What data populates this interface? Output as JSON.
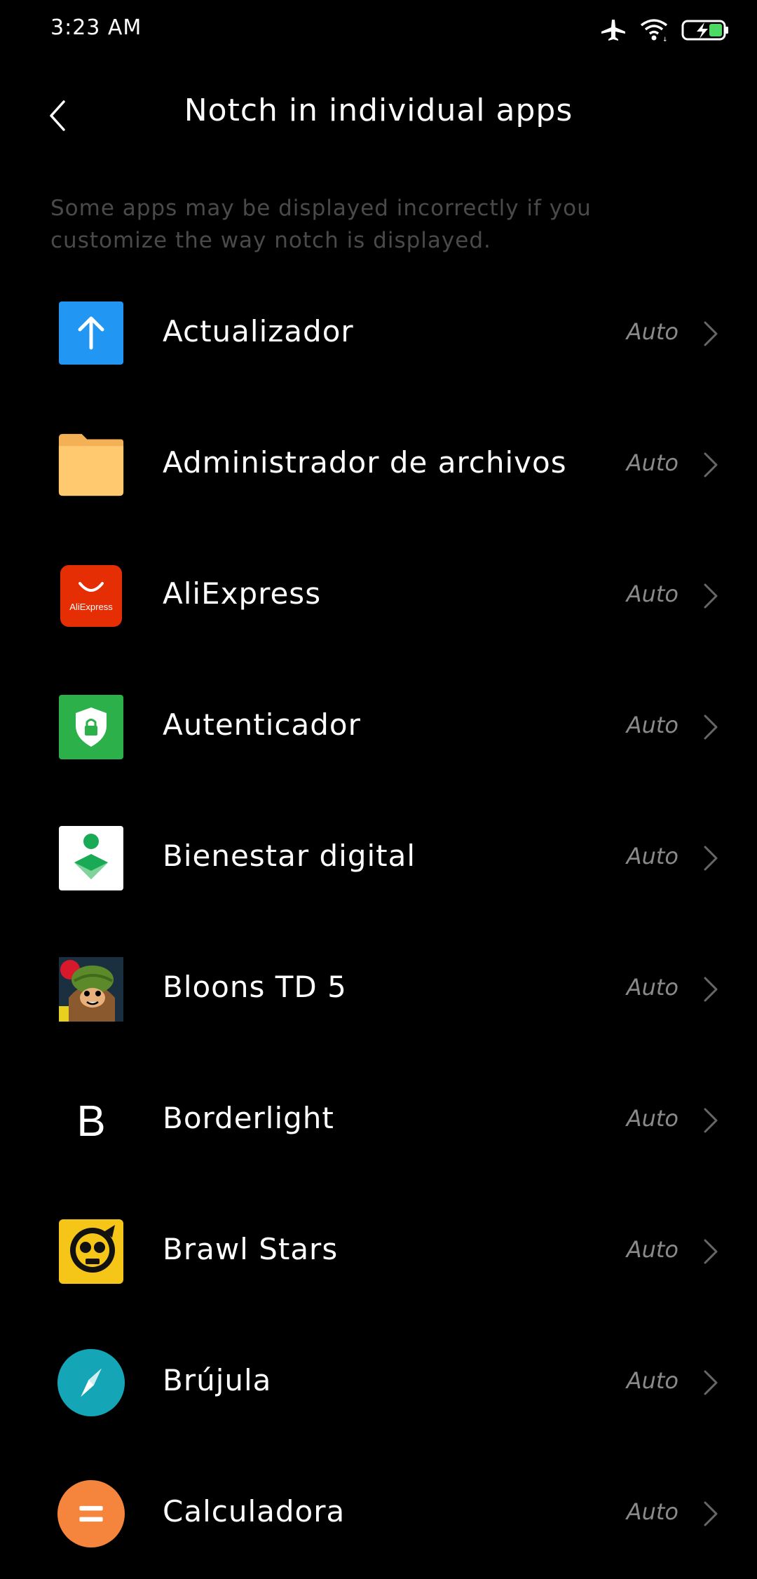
{
  "status_bar": {
    "time": "3:23 AM",
    "icons": [
      "airplane-icon",
      "wifi-icon",
      "battery-charging-icon"
    ]
  },
  "header": {
    "title": "Notch in individual apps",
    "back_icon": "chevron-left-icon"
  },
  "description": "Some apps may be displayed incorrectly if you customize the way notch is displayed.",
  "apps": [
    {
      "name": "Actualizador",
      "value": "Auto",
      "icon": "updater-icon"
    },
    {
      "name": "Administrador de archivos",
      "value": "Auto",
      "icon": "folder-icon"
    },
    {
      "name": "AliExpress",
      "value": "Auto",
      "icon": "aliexpress-icon",
      "icon_text": "AliExpress"
    },
    {
      "name": "Autenticador",
      "value": "Auto",
      "icon": "shield-lock-icon"
    },
    {
      "name": "Bienestar digital",
      "value": "Auto",
      "icon": "digital-wellbeing-icon"
    },
    {
      "name": "Bloons TD 5",
      "value": "Auto",
      "icon": "monkey-icon"
    },
    {
      "name": "Borderlight",
      "value": "Auto",
      "icon": "letter-b-icon",
      "icon_text": "B"
    },
    {
      "name": "Brawl Stars",
      "value": "Auto",
      "icon": "brawl-skull-icon"
    },
    {
      "name": "Brújula",
      "value": "Auto",
      "icon": "compass-icon"
    },
    {
      "name": "Calculadora",
      "value": "Auto",
      "icon": "calculator-icon"
    }
  ],
  "colors": {
    "background": "#000000",
    "text_primary": "#ffffff",
    "text_secondary": "#8a8a8a",
    "description": "#4a4a4a"
  }
}
